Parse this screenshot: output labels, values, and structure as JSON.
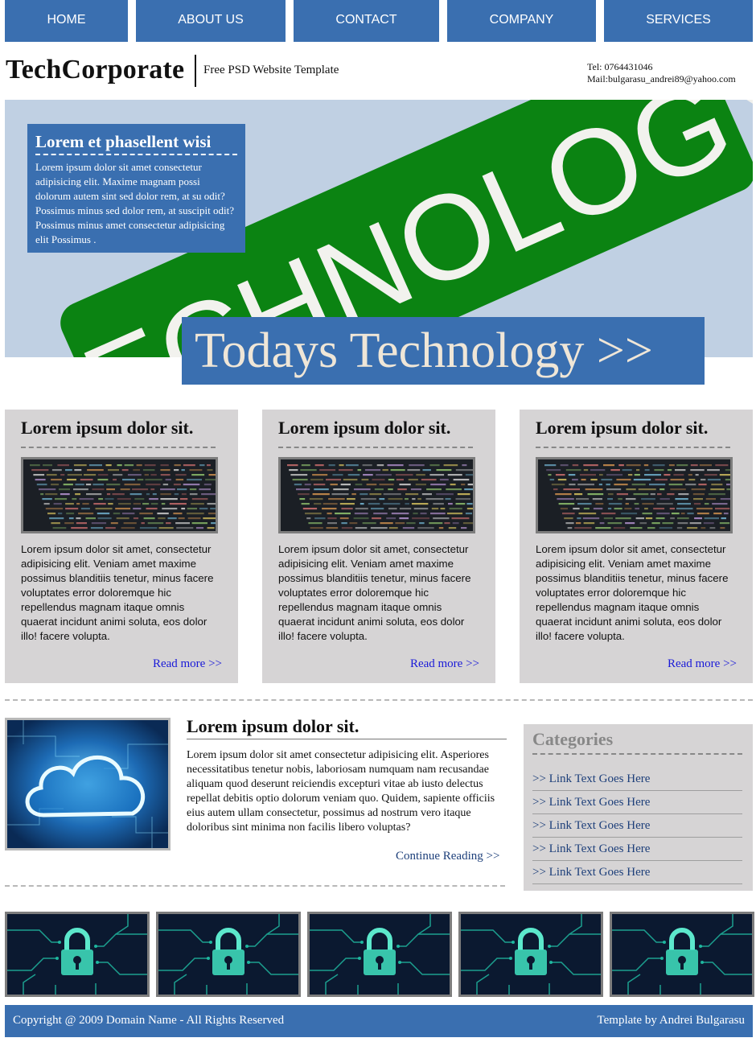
{
  "nav": {
    "items": [
      {
        "label": "HOME"
      },
      {
        "label": "ABOUT US"
      },
      {
        "label": "CONTACT"
      },
      {
        "label": "COMPANY"
      },
      {
        "label": "SERVICES"
      }
    ],
    "color": "#3a6fb0"
  },
  "header": {
    "brand": "TechCorporate",
    "tagline": "Free PSD Website Template",
    "phone": "Tel: 0764431046",
    "mail": "Mail:bulgarasu_andrei89@yahoo.com"
  },
  "banner": {
    "image_word": "TECHNOLOGY",
    "hero_title": "Lorem et phasellent wisi",
    "hero_text": "Lorem ipsum dolor sit amet consectetur adipisicing elit. Maxime magnam possi dolorum autem sint sed dolor rem, at su odit? Possimus minus sed dolor rem, at suscipit odit? Possimus minus amet consectetur adipisicing elit Possimus .",
    "cta_label": "Todays Technology >>"
  },
  "cards": [
    {
      "title": "Lorem ipsum dolor sit.",
      "text": "Lorem ipsum dolor sit amet, consectetur adipisicing elit. Veniam amet maxime possimus blanditiis tenetur, minus facere voluptates error doloremque hic repellendus magnam itaque omnis quaerat incidunt animi soluta, eos dolor illo! facere volupta.",
      "link": "Read more >>"
    },
    {
      "title": "Lorem ipsum dolor sit.",
      "text": "Lorem ipsum dolor sit amet, consectetur adipisicing elit. Veniam amet maxime possimus blanditiis tenetur, minus facere voluptates error doloremque hic repellendus magnam itaque omnis quaerat incidunt animi soluta, eos dolor illo! facere volupta.",
      "link": "Read more >>"
    },
    {
      "title": "Lorem ipsum dolor sit.",
      "text": "Lorem ipsum dolor sit amet, consectetur adipisicing elit. Veniam amet maxime possimus blanditiis tenetur, minus facere voluptates error doloremque hic repellendus magnam itaque omnis quaerat incidunt animi soluta, eos dolor illo! facere volupta.",
      "link": "Read more >>"
    }
  ],
  "feature": {
    "title": "Lorem ipsum dolor sit.",
    "text": "Lorem ipsum dolor sit amet consectetur adipisicing elit. Asperiores necessitatibus tenetur nobis, laboriosam numquam nam recusandae aliquam quod deserunt reiciendis excepturi vitae ab iusto delectus repellat debitis optio dolorum veniam quo. Quidem, sapiente officiis eius autem ullam consectetur, possimus ad nostrum vero itaque doloribus sint minima non facilis libero voluptas?",
    "link": "Continue Reading >>"
  },
  "categories": {
    "title": "Categories",
    "links": [
      ">> Link Text Goes Here",
      ">> Link Text Goes Here",
      ">> Link Text Goes Here",
      ">> Link Text Goes Here",
      ">> Link Text Goes Here"
    ]
  },
  "gallery": {
    "count": 5
  },
  "footer": {
    "copyright": "Copyright @ 2009 Domain Name - All Rights Reserved",
    "credit": "Template by Andrei Bulgarasu"
  }
}
